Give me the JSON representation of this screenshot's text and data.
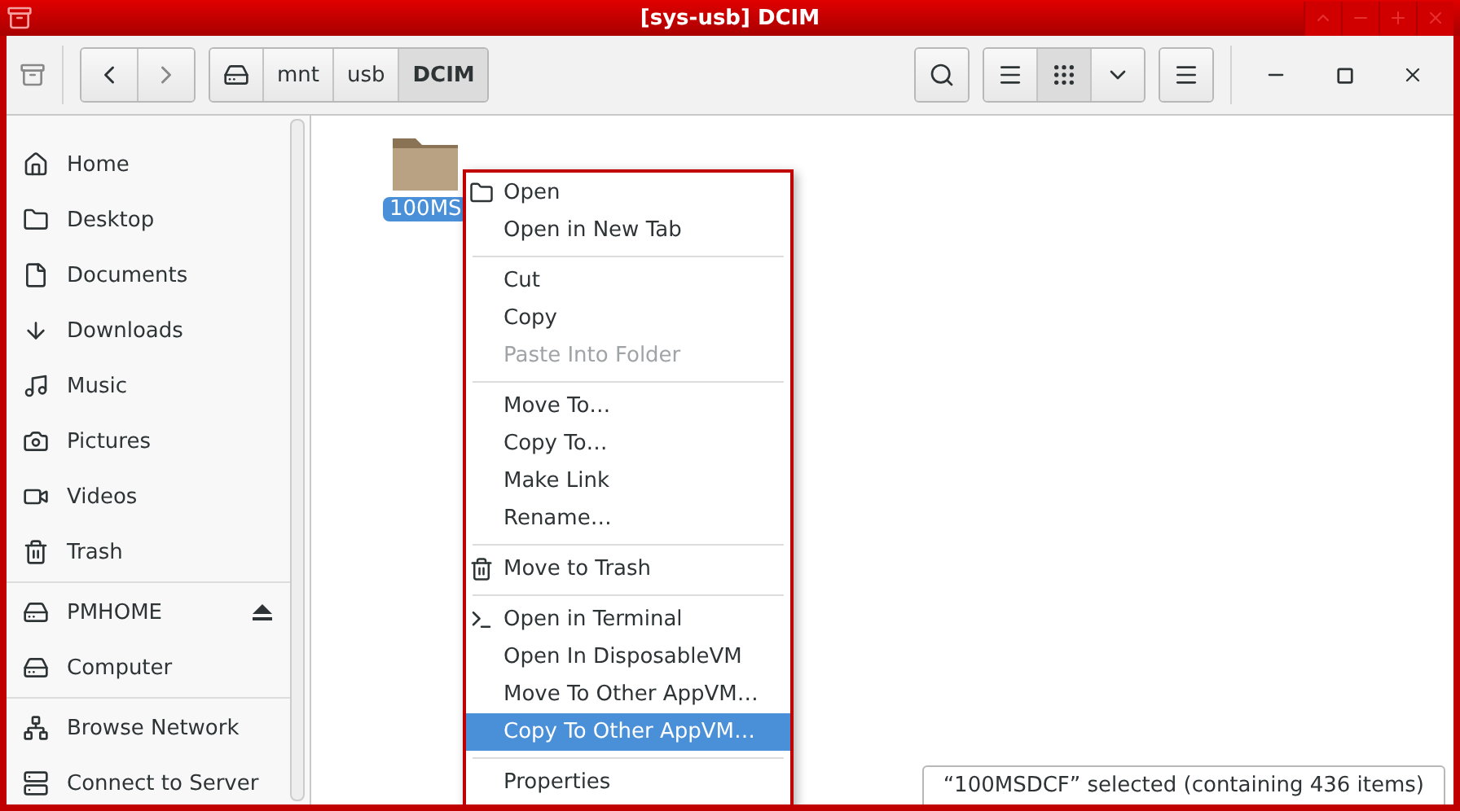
{
  "window": {
    "title": "[sys-usb] DCIM"
  },
  "toolbar": {
    "path": [
      {
        "kind": "drive",
        "selected": false
      },
      {
        "label": "mnt",
        "selected": false
      },
      {
        "label": "usb",
        "selected": false
      },
      {
        "label": "DCIM",
        "selected": true
      }
    ],
    "views": [
      {
        "kind": "list",
        "selected": false
      },
      {
        "kind": "grid",
        "selected": true
      },
      {
        "kind": "dropdown",
        "selected": false
      }
    ]
  },
  "sidebar": {
    "sections": [
      {
        "items": [
          {
            "label": "Home"
          },
          {
            "label": "Desktop"
          },
          {
            "label": "Documents"
          },
          {
            "label": "Downloads"
          },
          {
            "label": "Music"
          },
          {
            "label": "Pictures"
          },
          {
            "label": "Videos"
          },
          {
            "label": "Trash"
          }
        ]
      },
      {
        "items": [
          {
            "label": "PMHOME",
            "ejectable": true
          },
          {
            "label": "Computer",
            "ejectable": false
          }
        ]
      },
      {
        "items": [
          {
            "label": "Browse Network"
          },
          {
            "label": "Connect to Server"
          }
        ]
      }
    ]
  },
  "files": [
    {
      "label": "100MS",
      "selected": true
    }
  ],
  "context_menu": {
    "groups": [
      {
        "items": [
          {
            "label": "Open",
            "disabled": false,
            "selected": false
          },
          {
            "label": "Open in New Tab",
            "disabled": false,
            "selected": false
          }
        ]
      },
      {
        "items": [
          {
            "label": "Cut",
            "disabled": false,
            "selected": false
          },
          {
            "label": "Copy",
            "disabled": false,
            "selected": false
          },
          {
            "label": "Paste Into Folder",
            "disabled": true,
            "selected": false
          }
        ]
      },
      {
        "items": [
          {
            "label": "Move To…",
            "disabled": false,
            "selected": false
          },
          {
            "label": "Copy To…",
            "disabled": false,
            "selected": false
          },
          {
            "label": "Make Link",
            "disabled": false,
            "selected": false
          },
          {
            "label": "Rename…",
            "disabled": false,
            "selected": false
          }
        ]
      },
      {
        "items": [
          {
            "label": "Move to Trash",
            "disabled": false,
            "selected": false
          }
        ]
      },
      {
        "items": [
          {
            "label": "Open in Terminal",
            "disabled": false,
            "selected": false
          },
          {
            "label": "Open In DisposableVM",
            "disabled": false,
            "selected": false
          },
          {
            "label": "Move To Other AppVM…",
            "disabled": false,
            "selected": false
          },
          {
            "label": "Copy To Other AppVM…",
            "disabled": false,
            "selected": true
          }
        ]
      },
      {
        "items": [
          {
            "label": "Properties",
            "disabled": false,
            "selected": false
          }
        ]
      }
    ]
  },
  "status_bar": {
    "text": "“100MSDCF” selected (containing 436 items)"
  }
}
